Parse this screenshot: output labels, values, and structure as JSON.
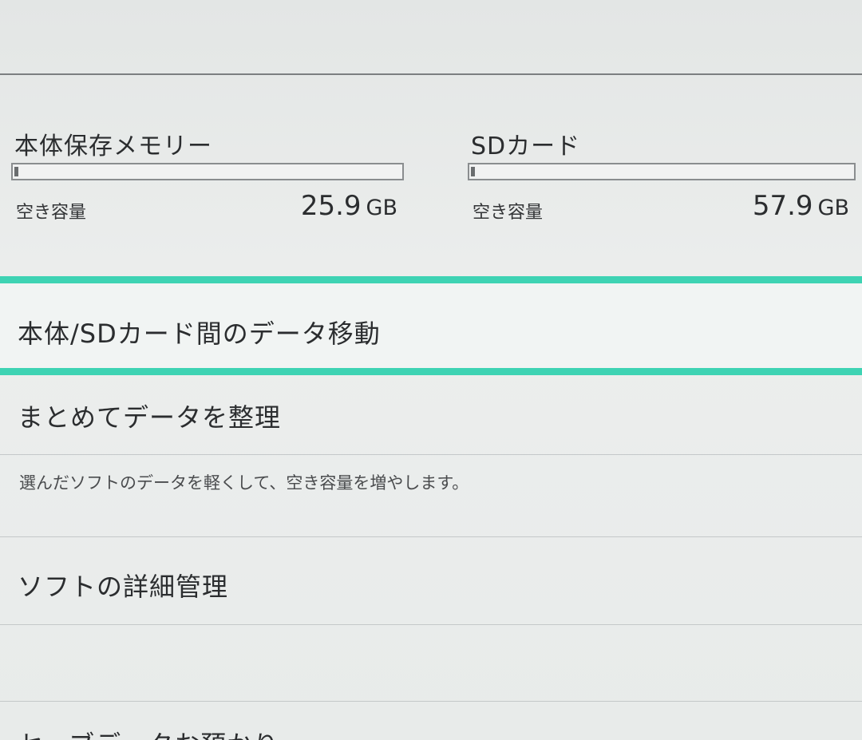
{
  "storage": {
    "internal": {
      "title": "本体保存メモリー",
      "usage_fraction": 0.01,
      "free_label": "空き容量",
      "free_value": "25.9",
      "free_unit": "GB"
    },
    "sd": {
      "title": "SDカード",
      "usage_fraction": 0.01,
      "free_label": "空き容量",
      "free_value": "57.9",
      "free_unit": "GB"
    }
  },
  "menu": {
    "move_data": {
      "label": "本体/SDカード間のデータ移動"
    },
    "organize": {
      "label": "まとめてデータを整理",
      "description": "選んだソフトのデータを軽くして、空き容量を増やします。"
    },
    "software_details": {
      "label": "ソフトの詳細管理"
    },
    "cutoff": {
      "label": "セーブデータお預かり"
    }
  },
  "colors": {
    "selection_accent": "#3ed3b3",
    "background": "#e9ebea"
  }
}
